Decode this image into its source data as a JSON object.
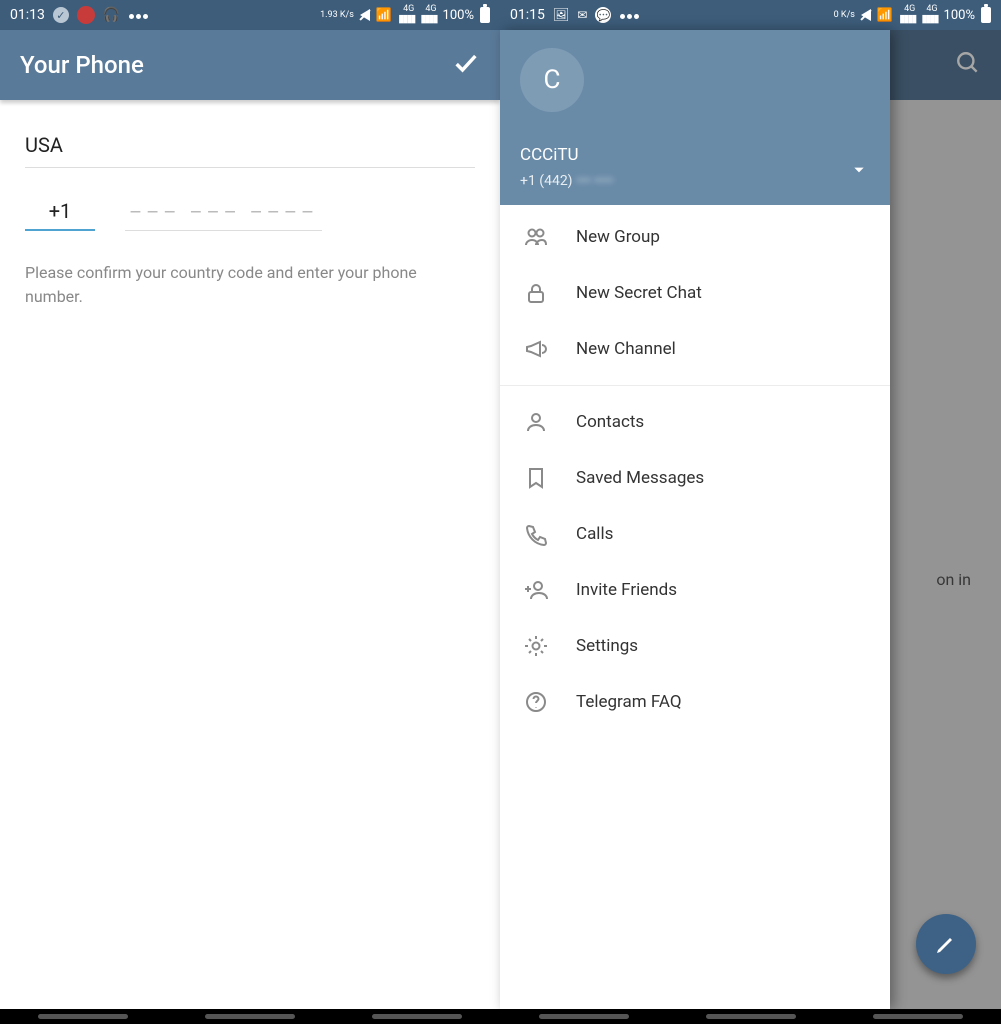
{
  "left": {
    "status": {
      "time": "01:13",
      "net_rate": "1.93 K/s",
      "net_label_top": "4G",
      "net_label_top2": "4G",
      "battery": "100%"
    },
    "appbar_title": "Your Phone",
    "country": "USA",
    "calling_code": "+1",
    "phone_placeholder": "––– ––– ––––",
    "hint": "Please confirm your country code and enter your phone number."
  },
  "right": {
    "status": {
      "time": "01:15",
      "net_rate": "0 K/s",
      "net_label_top": "4G",
      "net_label_top2": "4G",
      "battery": "100%"
    },
    "under_text_fragment": "on in",
    "account": {
      "initial": "C",
      "name": "CCCiTU",
      "phone_visible": "+1 (442)",
      "phone_hidden": "••• ••••"
    },
    "menu_group1": [
      {
        "icon": "group-icon",
        "label": "New Group"
      },
      {
        "icon": "lock-icon",
        "label": "New Secret Chat"
      },
      {
        "icon": "megaphone-icon",
        "label": "New Channel"
      }
    ],
    "menu_group2": [
      {
        "icon": "person-icon",
        "label": "Contacts"
      },
      {
        "icon": "bookmark-icon",
        "label": "Saved Messages"
      },
      {
        "icon": "phone-icon",
        "label": "Calls"
      },
      {
        "icon": "add-person-icon",
        "label": "Invite Friends"
      },
      {
        "icon": "gear-icon",
        "label": "Settings"
      },
      {
        "icon": "help-icon",
        "label": "Telegram FAQ"
      }
    ]
  }
}
